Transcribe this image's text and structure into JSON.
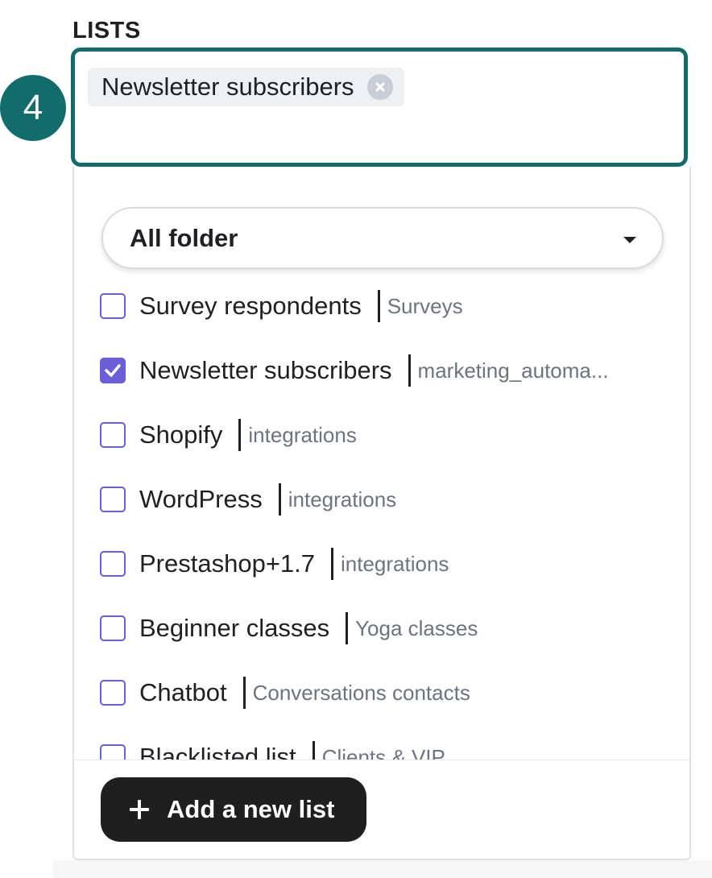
{
  "section": {
    "label": "LISTS"
  },
  "step": {
    "number": "4",
    "color": "#136c6c"
  },
  "selected_chips": [
    {
      "label": "Newsletter subscribers",
      "icon": "close-circle-icon"
    }
  ],
  "folder_select": {
    "value": "All folder",
    "icon": "caret-down-icon"
  },
  "lists": [
    {
      "name": "Survey respondents",
      "folder": "Surveys",
      "checked": false
    },
    {
      "name": "Newsletter subscribers",
      "folder": "marketing_automa...",
      "checked": true
    },
    {
      "name": "Shopify",
      "folder": "integrations",
      "checked": false
    },
    {
      "name": "WordPress",
      "folder": "integrations",
      "checked": false
    },
    {
      "name": "Prestashop+1.7",
      "folder": "integrations",
      "checked": false
    },
    {
      "name": "Beginner classes",
      "folder": "Yoga classes",
      "checked": false
    },
    {
      "name": "Chatbot",
      "folder": "Conversations contacts",
      "checked": false
    },
    {
      "name": "Blacklisted list",
      "folder": "Clients & VIP",
      "checked": false
    }
  ],
  "add_button": {
    "label": "Add a new list",
    "icon": "plus-icon"
  },
  "colors": {
    "accent": "#136c6c",
    "checkbox": "#6a5fd8",
    "button": "#1f1f1f",
    "folder_text": "#6b7480"
  }
}
